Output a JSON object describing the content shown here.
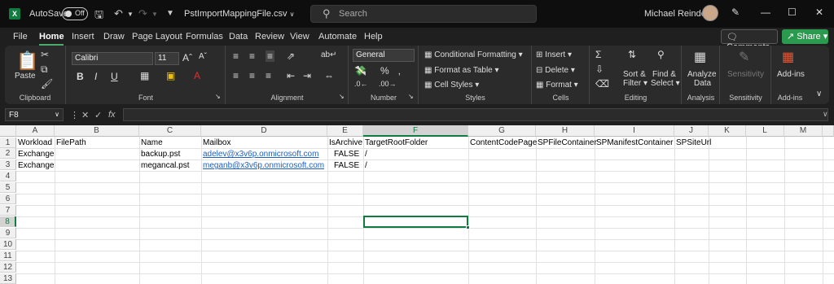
{
  "window": {
    "autosave_label": "AutoSave",
    "autosave_state": "Off",
    "file_name": "PstImportMappingFile.csv",
    "search_placeholder": "Search",
    "user_name": "Michael Reinders"
  },
  "menu": {
    "tabs": [
      "File",
      "Home",
      "Insert",
      "Draw",
      "Page Layout",
      "Formulas",
      "Data",
      "Review",
      "View",
      "Automate",
      "Help"
    ],
    "active": "Home",
    "comments_label": "Comments",
    "share_label": "Share"
  },
  "ribbon": {
    "clipboard": {
      "paste": "Paste",
      "label": "Clipboard"
    },
    "font": {
      "name": "Calibri",
      "size": "11",
      "label": "Font"
    },
    "alignment": {
      "label": "Alignment"
    },
    "number": {
      "format": "General",
      "label": "Number"
    },
    "styles": {
      "conditional": "Conditional Formatting",
      "table": "Format as Table",
      "cell": "Cell Styles",
      "label": "Styles"
    },
    "cells": {
      "insert": "Insert",
      "delete": "Delete",
      "format": "Format",
      "label": "Cells"
    },
    "editing": {
      "sort1": "Sort &",
      "sort2": "Filter",
      "find1": "Find &",
      "find2": "Select",
      "label": "Editing"
    },
    "analysis": {
      "btn1": "Analyze",
      "btn2": "Data",
      "label": "Analysis"
    },
    "sensitivity": {
      "btn": "Sensitivity",
      "label": "Sensitivity"
    },
    "addins": {
      "btn": "Add-ins",
      "label": "Add-ins"
    }
  },
  "formula_bar": {
    "name_box": "F8",
    "fx": "fx",
    "value": ""
  },
  "sheet": {
    "columns": [
      "A",
      "B",
      "C",
      "D",
      "E",
      "F",
      "G",
      "H",
      "I",
      "J",
      "K",
      "L",
      "M"
    ],
    "selected_column": "F",
    "selected_row": "8",
    "rows": [
      "1",
      "2",
      "3",
      "4",
      "5",
      "6",
      "7",
      "8",
      "9",
      "10",
      "11",
      "12",
      "13"
    ],
    "headers": [
      "Workload",
      "FilePath",
      "Name",
      "Mailbox",
      "IsArchive",
      "TargetRootFolder",
      "ContentCodePage",
      "SPFileContainer",
      "SPManifestContainer",
      "SPSiteUrl"
    ],
    "data": [
      {
        "workload": "Exchange",
        "name": "backup.pst",
        "mailbox": "adelev@x3v6p.onmicrosoft.com",
        "isarchive": "FALSE",
        "target": "/"
      },
      {
        "workload": "Exchange",
        "name": "megancal.pst",
        "mailbox": "meganb@x3v6p.onmicrosoft.com",
        "isarchive": "FALSE",
        "target": "/"
      }
    ]
  }
}
